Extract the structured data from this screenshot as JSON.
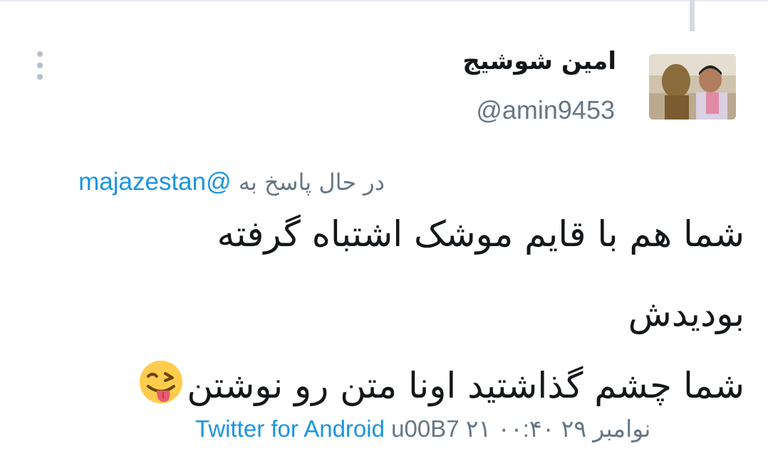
{
  "tweet": {
    "author_name": "امین شوشیج",
    "author_handle": "@amin9453",
    "reply_prefix": "در حال پاسخ به",
    "reply_mention": "@majazestan",
    "text_line1": "شما هم با قایم موشک اشتباه گرفته",
    "text_line2": "بودیدش",
    "text_line3": "شما چشم گذاشتید اونا متن رو نوشتن",
    "emoji": "winking-face-with-tongue",
    "source": "Twitter for Android",
    "separator": "u00B7",
    "date": "۲۱ نوامبر ۲۹",
    "time": "۰۰:۴۰"
  },
  "colors": {
    "text": "#14171a",
    "muted": "#657786",
    "link": "#1b95e0",
    "emoji_face": "#ffcc4d"
  },
  "icons": {
    "more": "more-vertical-icon"
  }
}
